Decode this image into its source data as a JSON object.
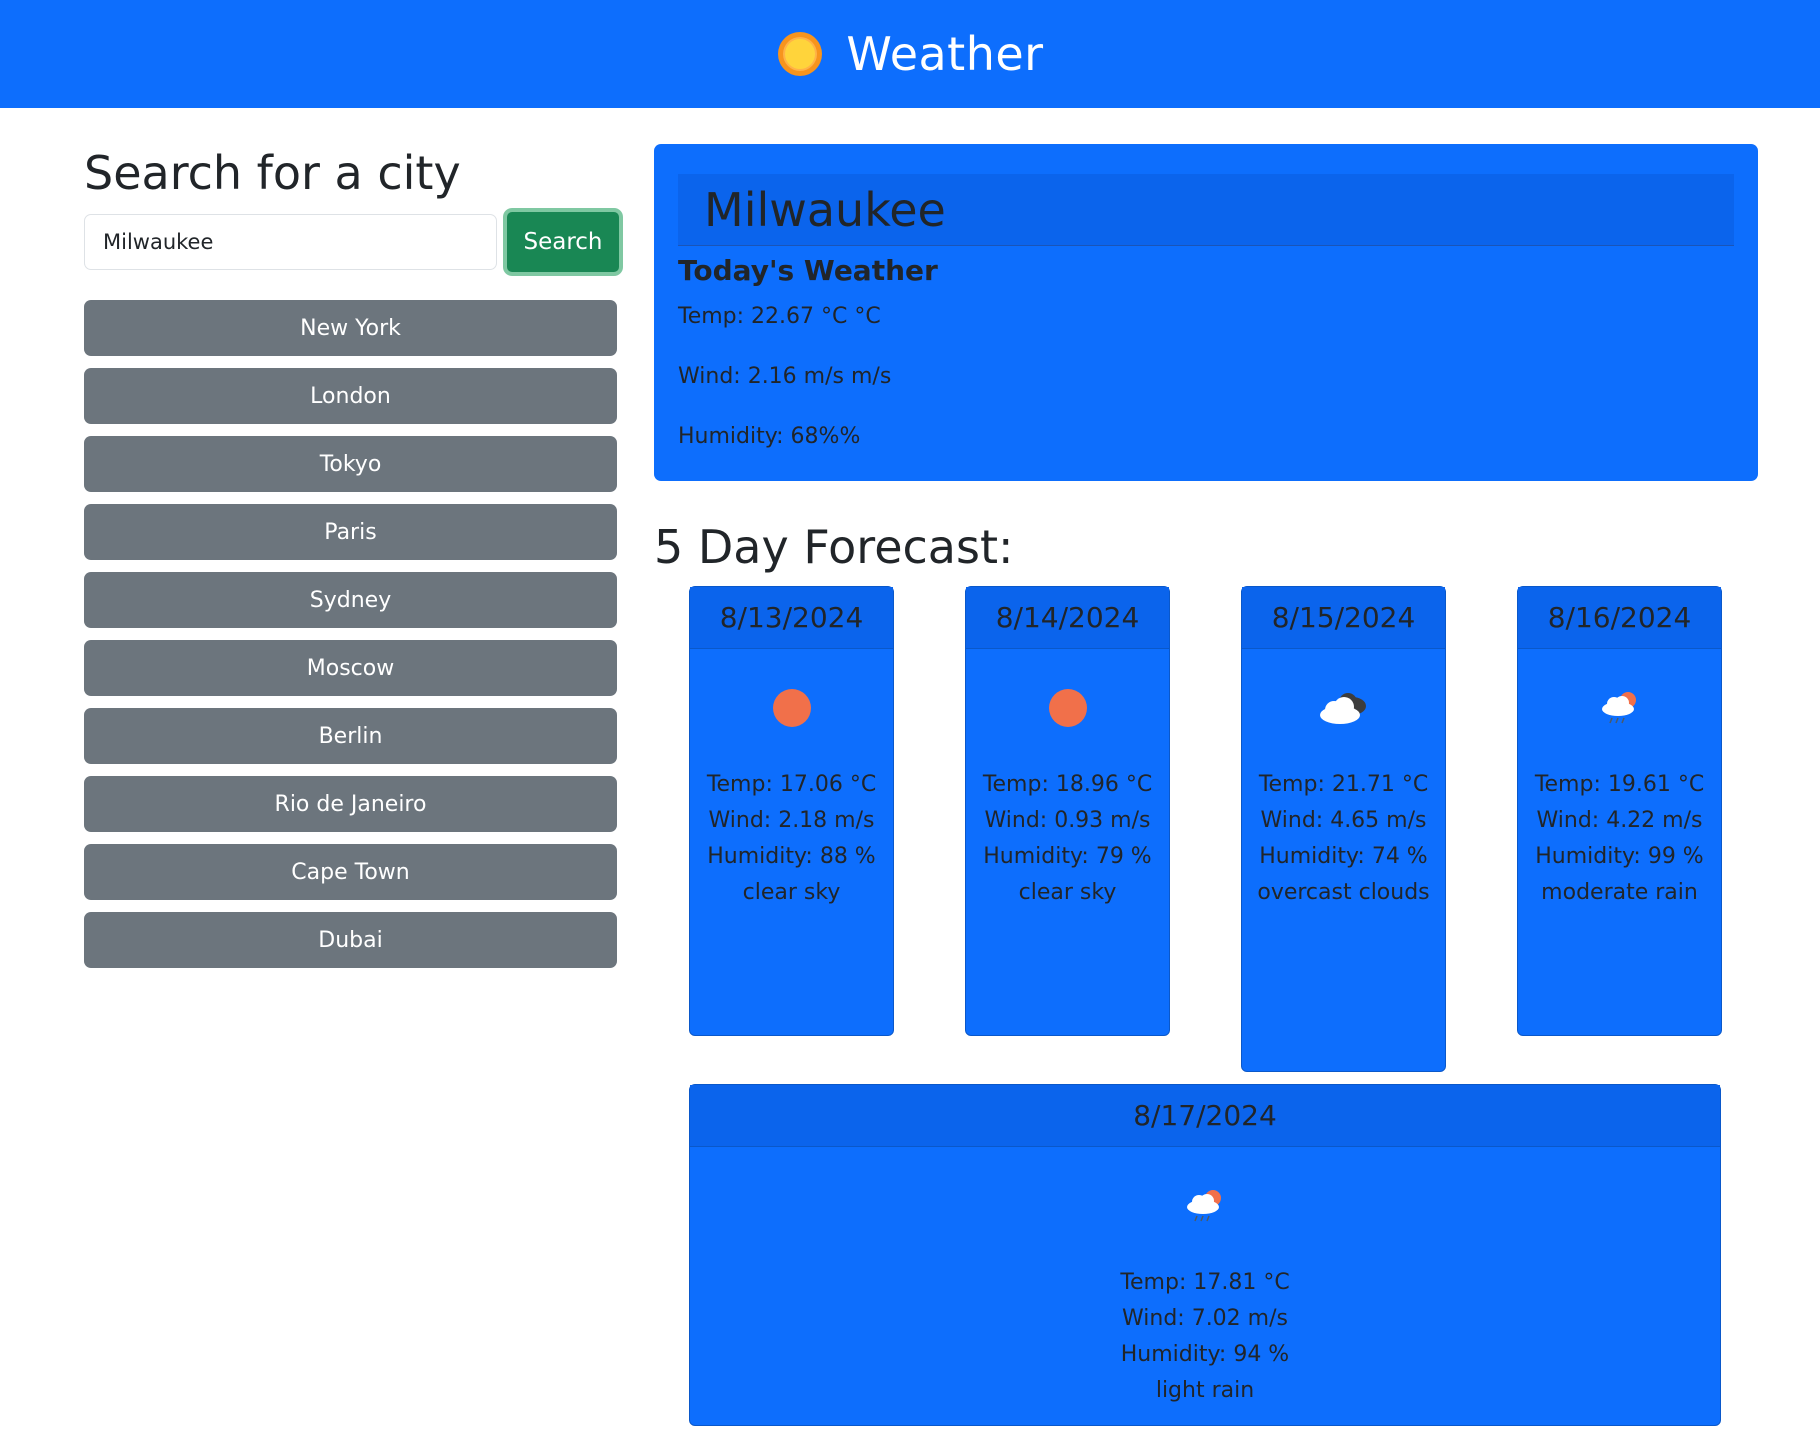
{
  "navbar": {
    "title": "Weather",
    "icon": "sun-icon"
  },
  "search": {
    "heading": "Search for a city",
    "value": "Milwaukee",
    "button_label": "Search"
  },
  "cities": [
    "New York",
    "London",
    "Tokyo",
    "Paris",
    "Sydney",
    "Moscow",
    "Berlin",
    "Rio de Janeiro",
    "Cape Town",
    "Dubai"
  ],
  "today": {
    "city": "Milwaukee",
    "subtitle": "Today's Weather",
    "temp": "Temp: 22.67 °C °C",
    "wind": "Wind: 2.16 m/s m/s",
    "humidity": "Humidity: 68%%"
  },
  "forecast": {
    "heading": "5 Day Forecast:",
    "days": [
      {
        "date": "8/13/2024",
        "icon": "clear-sky-icon",
        "temp": "Temp: 17.06 °C",
        "wind": "Wind: 2.18 m/s",
        "humidity": "Humidity: 88 %",
        "description": "clear sky"
      },
      {
        "date": "8/14/2024",
        "icon": "clear-sky-icon",
        "temp": "Temp: 18.96 °C",
        "wind": "Wind: 0.93 m/s",
        "humidity": "Humidity: 79 %",
        "description": "clear sky"
      },
      {
        "date": "8/15/2024",
        "icon": "overcast-clouds-icon",
        "temp": "Temp: 21.71 °C",
        "wind": "Wind: 4.65 m/s",
        "humidity": "Humidity: 74 %",
        "description": "overcast clouds"
      },
      {
        "date": "8/16/2024",
        "icon": "rain-icon",
        "temp": "Temp: 19.61 °C",
        "wind": "Wind: 4.22 m/s",
        "humidity": "Humidity: 99 %",
        "description": "moderate rain"
      },
      {
        "date": "8/17/2024",
        "icon": "rain-icon",
        "temp": "Temp: 17.81 °C",
        "wind": "Wind: 7.02 m/s",
        "humidity": "Humidity: 94 %",
        "description": "light rain"
      }
    ]
  },
  "colors": {
    "primary": "#0d6efd",
    "success": "#198754",
    "secondary": "#6c757d",
    "sun": "#f1704a"
  }
}
